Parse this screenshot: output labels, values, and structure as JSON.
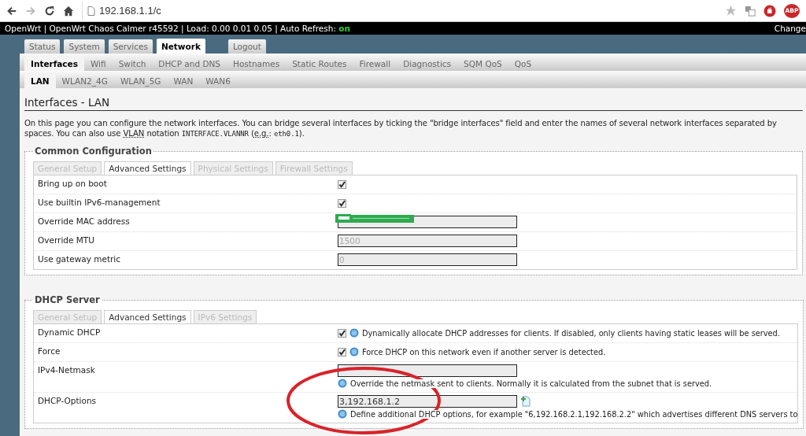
{
  "browser": {
    "url": "192.168.1.1/c",
    "extension_badge": "ABP"
  },
  "header": {
    "text": "OpenWrt | OpenWrt Chaos Calmer r45592 | Load: 0.00 0.01 0.05 | Auto Refresh: ",
    "refresh_state": "on",
    "right_text": "Change"
  },
  "main_tabs": [
    {
      "label": "Status",
      "selected": false
    },
    {
      "label": "System",
      "selected": false
    },
    {
      "label": "Services",
      "selected": false
    },
    {
      "label": "Network",
      "selected": true
    },
    {
      "label": "Logout",
      "selected": false,
      "kind": "logout"
    }
  ],
  "sub_tabs": [
    {
      "label": "Interfaces",
      "selected": true
    },
    {
      "label": "Wifi",
      "selected": false
    },
    {
      "label": "Switch",
      "selected": false
    },
    {
      "label": "DHCP and DNS",
      "selected": false
    },
    {
      "label": "Hostnames",
      "selected": false
    },
    {
      "label": "Static Routes",
      "selected": false
    },
    {
      "label": "Firewall",
      "selected": false
    },
    {
      "label": "Diagnostics",
      "selected": false
    },
    {
      "label": "SQM QoS",
      "selected": false
    },
    {
      "label": "QoS",
      "selected": false
    }
  ],
  "interface_tabs": [
    {
      "label": "LAN",
      "selected": true
    },
    {
      "label": "WLAN2_4G",
      "selected": false
    },
    {
      "label": "WLAN_5G",
      "selected": false
    },
    {
      "label": "WAN",
      "selected": false
    },
    {
      "label": "WAN6",
      "selected": false
    }
  ],
  "page_title": "Interfaces - LAN",
  "description": [
    {
      "kind": "text",
      "text": "On this page you can configure the network interfaces. You can bridge several interfaces by ticking the \"bridge interfaces\" field and enter the names of several network interfaces separated by spaces. You can also use "
    },
    {
      "kind": "abbr",
      "text": "VLAN"
    },
    {
      "kind": "text",
      "text": " notation "
    },
    {
      "kind": "code",
      "text": "INTERFACE.VLANNR"
    },
    {
      "kind": "text",
      "text": " ("
    },
    {
      "kind": "abbr",
      "text": "e.g."
    },
    {
      "kind": "text",
      "text": ": "
    },
    {
      "kind": "code",
      "text": "eth0.1"
    },
    {
      "kind": "text",
      "text": ")."
    }
  ],
  "sections": [
    {
      "legend": "Common Configuration",
      "tabs": [
        {
          "label": "General Setup",
          "selected": false
        },
        {
          "label": "Advanced Settings",
          "selected": true
        },
        {
          "label": "Physical Settings",
          "selected": false
        },
        {
          "label": "Firewall Settings",
          "selected": false
        }
      ],
      "rows": [
        {
          "label": "Bring up on boot",
          "kind": "checkbox",
          "checked": true
        },
        {
          "label": "Use builtin IPv6-management",
          "kind": "checkbox",
          "checked": true
        },
        {
          "label": "Override MAC address",
          "kind": "input",
          "redacted": true
        },
        {
          "label": "Override MTU",
          "kind": "input",
          "placeholder": "1500"
        },
        {
          "label": "Use gateway metric",
          "kind": "input",
          "placeholder": "0"
        }
      ]
    },
    {
      "legend": "DHCP Server",
      "tabs": [
        {
          "label": "General Setup",
          "selected": false
        },
        {
          "label": "Advanced Settings",
          "selected": true
        },
        {
          "label": "IPv6 Settings",
          "selected": false
        }
      ],
      "rows": [
        {
          "label": "Dynamic DHCP",
          "kind": "checkbox",
          "checked": true,
          "help": "Dynamically allocate DHCP addresses for clients. If disabled, only clients having static leases will be served."
        },
        {
          "label": "Force",
          "kind": "checkbox",
          "checked": true,
          "help": "Force DHCP on this network even if another server is detected."
        },
        {
          "label": "IPv4-Netmask",
          "kind": "input",
          "help": "Override the netmask sent to clients. Normally it is calculated from the subnet that is served."
        },
        {
          "label": "DHCP-Options",
          "kind": "list-input",
          "value": "3,192.168.1.2",
          "help": "Define additional DHCP options, for example \"6,192.168.2.1,192.168.2.2\" which advertises different DNS servers to"
        }
      ]
    }
  ],
  "annotations": [
    {
      "kind": "ellipse"
    }
  ]
}
